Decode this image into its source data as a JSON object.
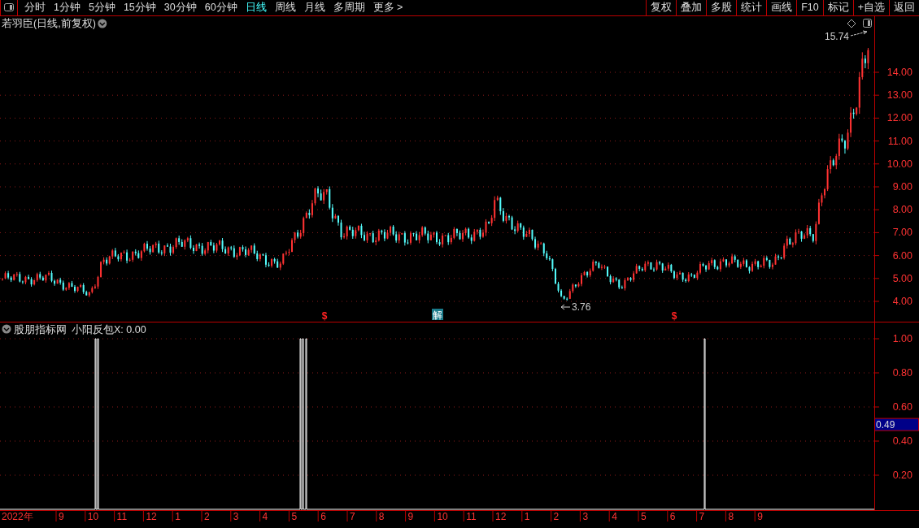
{
  "toolbar": {
    "periods": [
      {
        "label": "分时",
        "selected": false
      },
      {
        "label": "1分钟",
        "selected": false
      },
      {
        "label": "5分钟",
        "selected": false
      },
      {
        "label": "15分钟",
        "selected": false
      },
      {
        "label": "30分钟",
        "selected": false
      },
      {
        "label": "60分钟",
        "selected": false
      },
      {
        "label": "日线",
        "selected": true
      },
      {
        "label": "周线",
        "selected": false
      },
      {
        "label": "月线",
        "selected": false
      },
      {
        "label": "多周期",
        "selected": false
      },
      {
        "label": "更多 >",
        "selected": false
      }
    ],
    "actions": [
      "复权",
      "叠加",
      "多股",
      "统计",
      "画线",
      "F10",
      "标记",
      "+自选",
      "返回"
    ]
  },
  "main_chart": {
    "title": "若羽臣(日线,前复权)",
    "high_label": "15.74",
    "low_label": "3.76",
    "price_ticks": [
      "14.00",
      "13.00",
      "12.00",
      "11.00",
      "10.00",
      "9.00",
      "8.00",
      "7.00",
      "6.00",
      "5.00",
      "4.00"
    ],
    "markers": [
      {
        "kind": "dollar",
        "label": "$"
      },
      {
        "kind": "unlock",
        "label": "解"
      },
      {
        "kind": "dollar",
        "label": "$"
      }
    ]
  },
  "indicator": {
    "source": "股朋指标网",
    "name": "小阳反包X: 0.00",
    "ticks": [
      "1.00",
      "0.80",
      "0.60",
      "0.40",
      "0.20"
    ],
    "cursor_value": "0.49"
  },
  "time_axis": {
    "labels": [
      "2022年",
      "9",
      "10",
      "11",
      "12",
      "1",
      "2",
      "3",
      "4",
      "5",
      "6",
      "7",
      "8",
      "9",
      "10",
      "11",
      "12",
      "1",
      "2",
      "3",
      "4",
      "5",
      "6",
      "7",
      "8",
      "9"
    ]
  }
}
